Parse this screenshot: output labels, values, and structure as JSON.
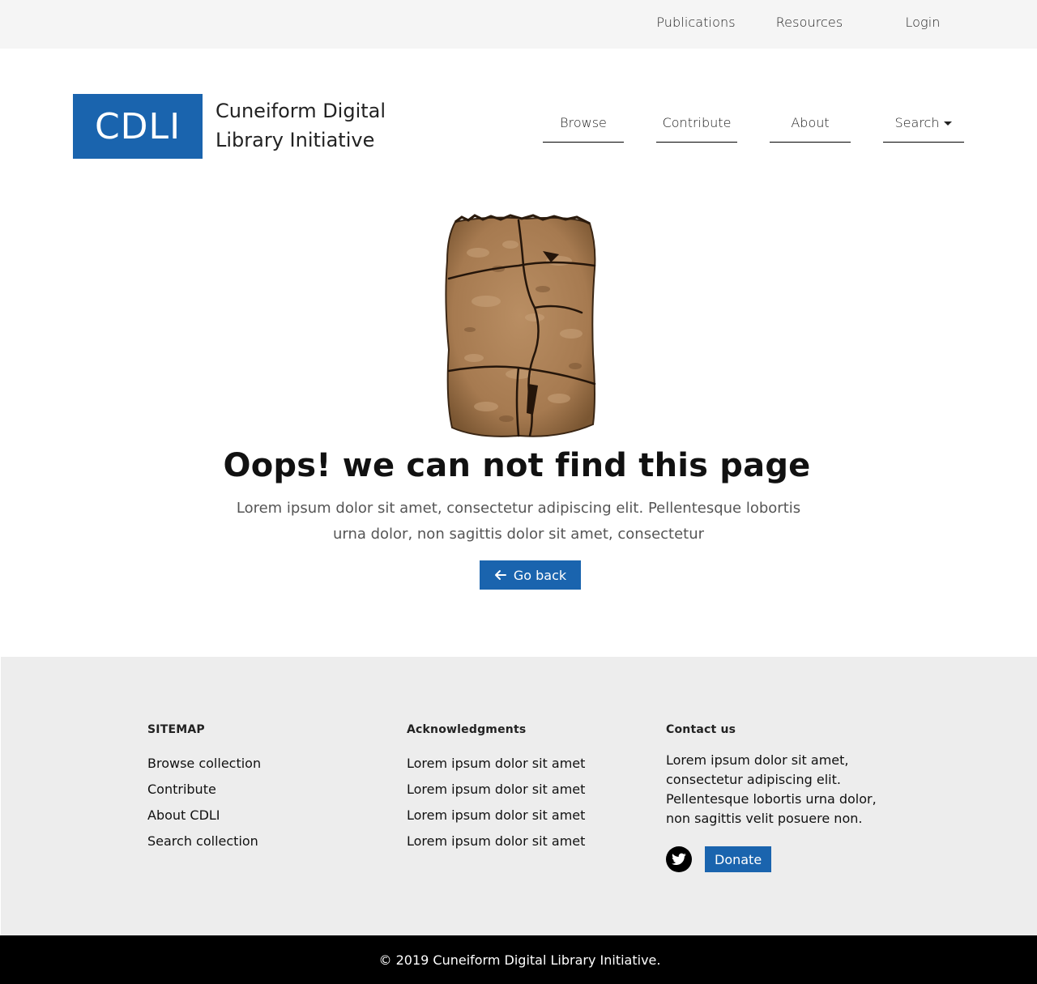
{
  "topbar": {
    "links": [
      "Publications",
      "Resources",
      "Login"
    ]
  },
  "header": {
    "logo_text": "CDLI",
    "title_line1": "Cuneiform Digital",
    "title_line2": "Library Initiative",
    "nav": [
      "Browse",
      "Contribute",
      "About",
      "Search"
    ]
  },
  "error": {
    "title": "Oops! we can not find this page",
    "description": "Lorem ipsum dolor sit amet, consectetur adipiscing elit. Pellentesque lobortis urna dolor, non sagittis dolor sit amet, consectetur",
    "button_label": "Go back"
  },
  "footer": {
    "sitemap": {
      "heading": "SITEMAP",
      "links": [
        "Browse collection",
        "Contribute",
        "About CDLI",
        "Search collection"
      ]
    },
    "acknowledgments": {
      "heading": "Acknowledgments",
      "links": [
        "Lorem ipsum dolor sit amet",
        "Lorem ipsum dolor sit amet",
        "Lorem ipsum dolor sit amet",
        "Lorem ipsum dolor sit amet"
      ]
    },
    "contact": {
      "heading": "Contact us",
      "text": "Lorem ipsum dolor sit amet, consectetur adipiscing elit. Pellentesque lobortis urna dolor, non sagittis velit posuere non.",
      "donate_label": "Donate",
      "social_icon": "twitter-icon"
    },
    "copyright": "© 2019 Cuneiform Digital Library Initiative."
  },
  "colors": {
    "brand_blue": "#1a64ae",
    "topbar_bg": "#f5f5f5",
    "footer_bg": "#ededed",
    "bottom_bar_bg": "#000000"
  }
}
